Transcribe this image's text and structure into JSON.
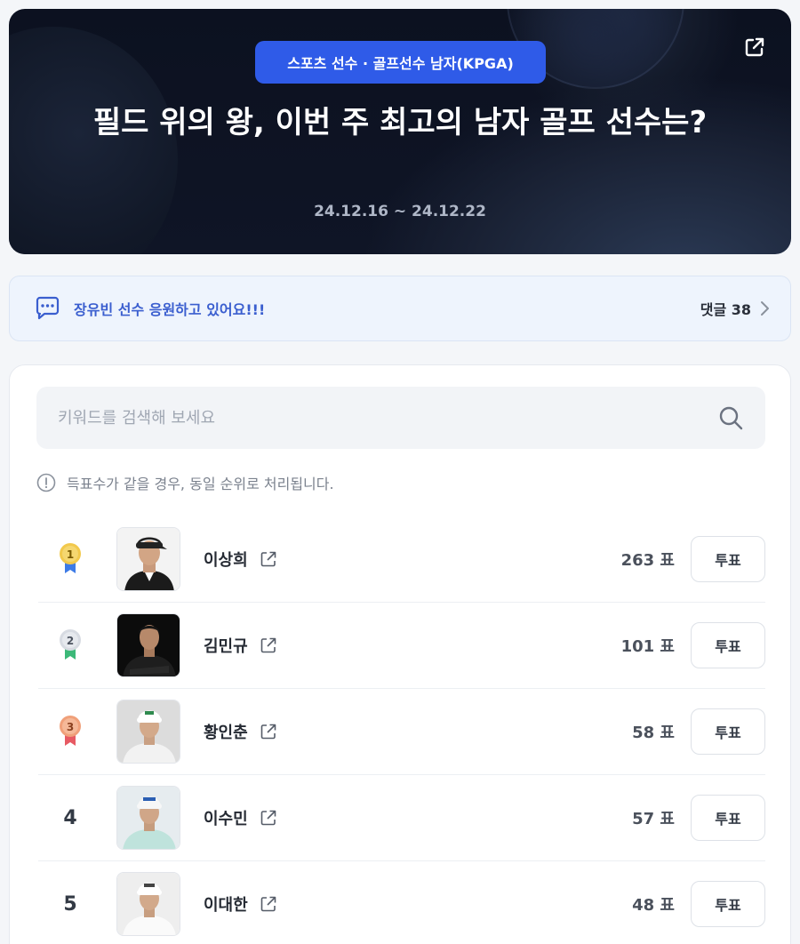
{
  "hero": {
    "category": "스포츠 선수 · 골프선수 남자(KPGA)",
    "title": "필드 위의 왕, 이번 주 최고의 남자 골프 선수는?",
    "date_range": "24.12.16 ~ 24.12.22"
  },
  "comment_bar": {
    "text": "장유빈 선수 응원하고 있어요!!!",
    "count_label": "댓글 38"
  },
  "search": {
    "placeholder": "키워드를 검색해 보세요"
  },
  "notice": "득표수가 같을 경우, 동일 순위로 처리됩니다.",
  "players": [
    {
      "rank": "1",
      "name": "이상희",
      "votes": "263 표",
      "vote_label": "투표",
      "medal": "gold"
    },
    {
      "rank": "2",
      "name": "김민규",
      "votes": "101 표",
      "vote_label": "투표",
      "medal": "silver"
    },
    {
      "rank": "3",
      "name": "황인춘",
      "votes": "58 표",
      "vote_label": "투표",
      "medal": "bronze"
    },
    {
      "rank": "4",
      "name": "이수민",
      "votes": "57 표",
      "vote_label": "투표",
      "medal": ""
    },
    {
      "rank": "5",
      "name": "이대한",
      "votes": "48 표",
      "vote_label": "투표",
      "medal": ""
    }
  ],
  "colors": {
    "accent": "#2f5be8",
    "gold": "#f2c94c",
    "silver": "#d7dbe2",
    "bronze": "#f0a07a"
  }
}
